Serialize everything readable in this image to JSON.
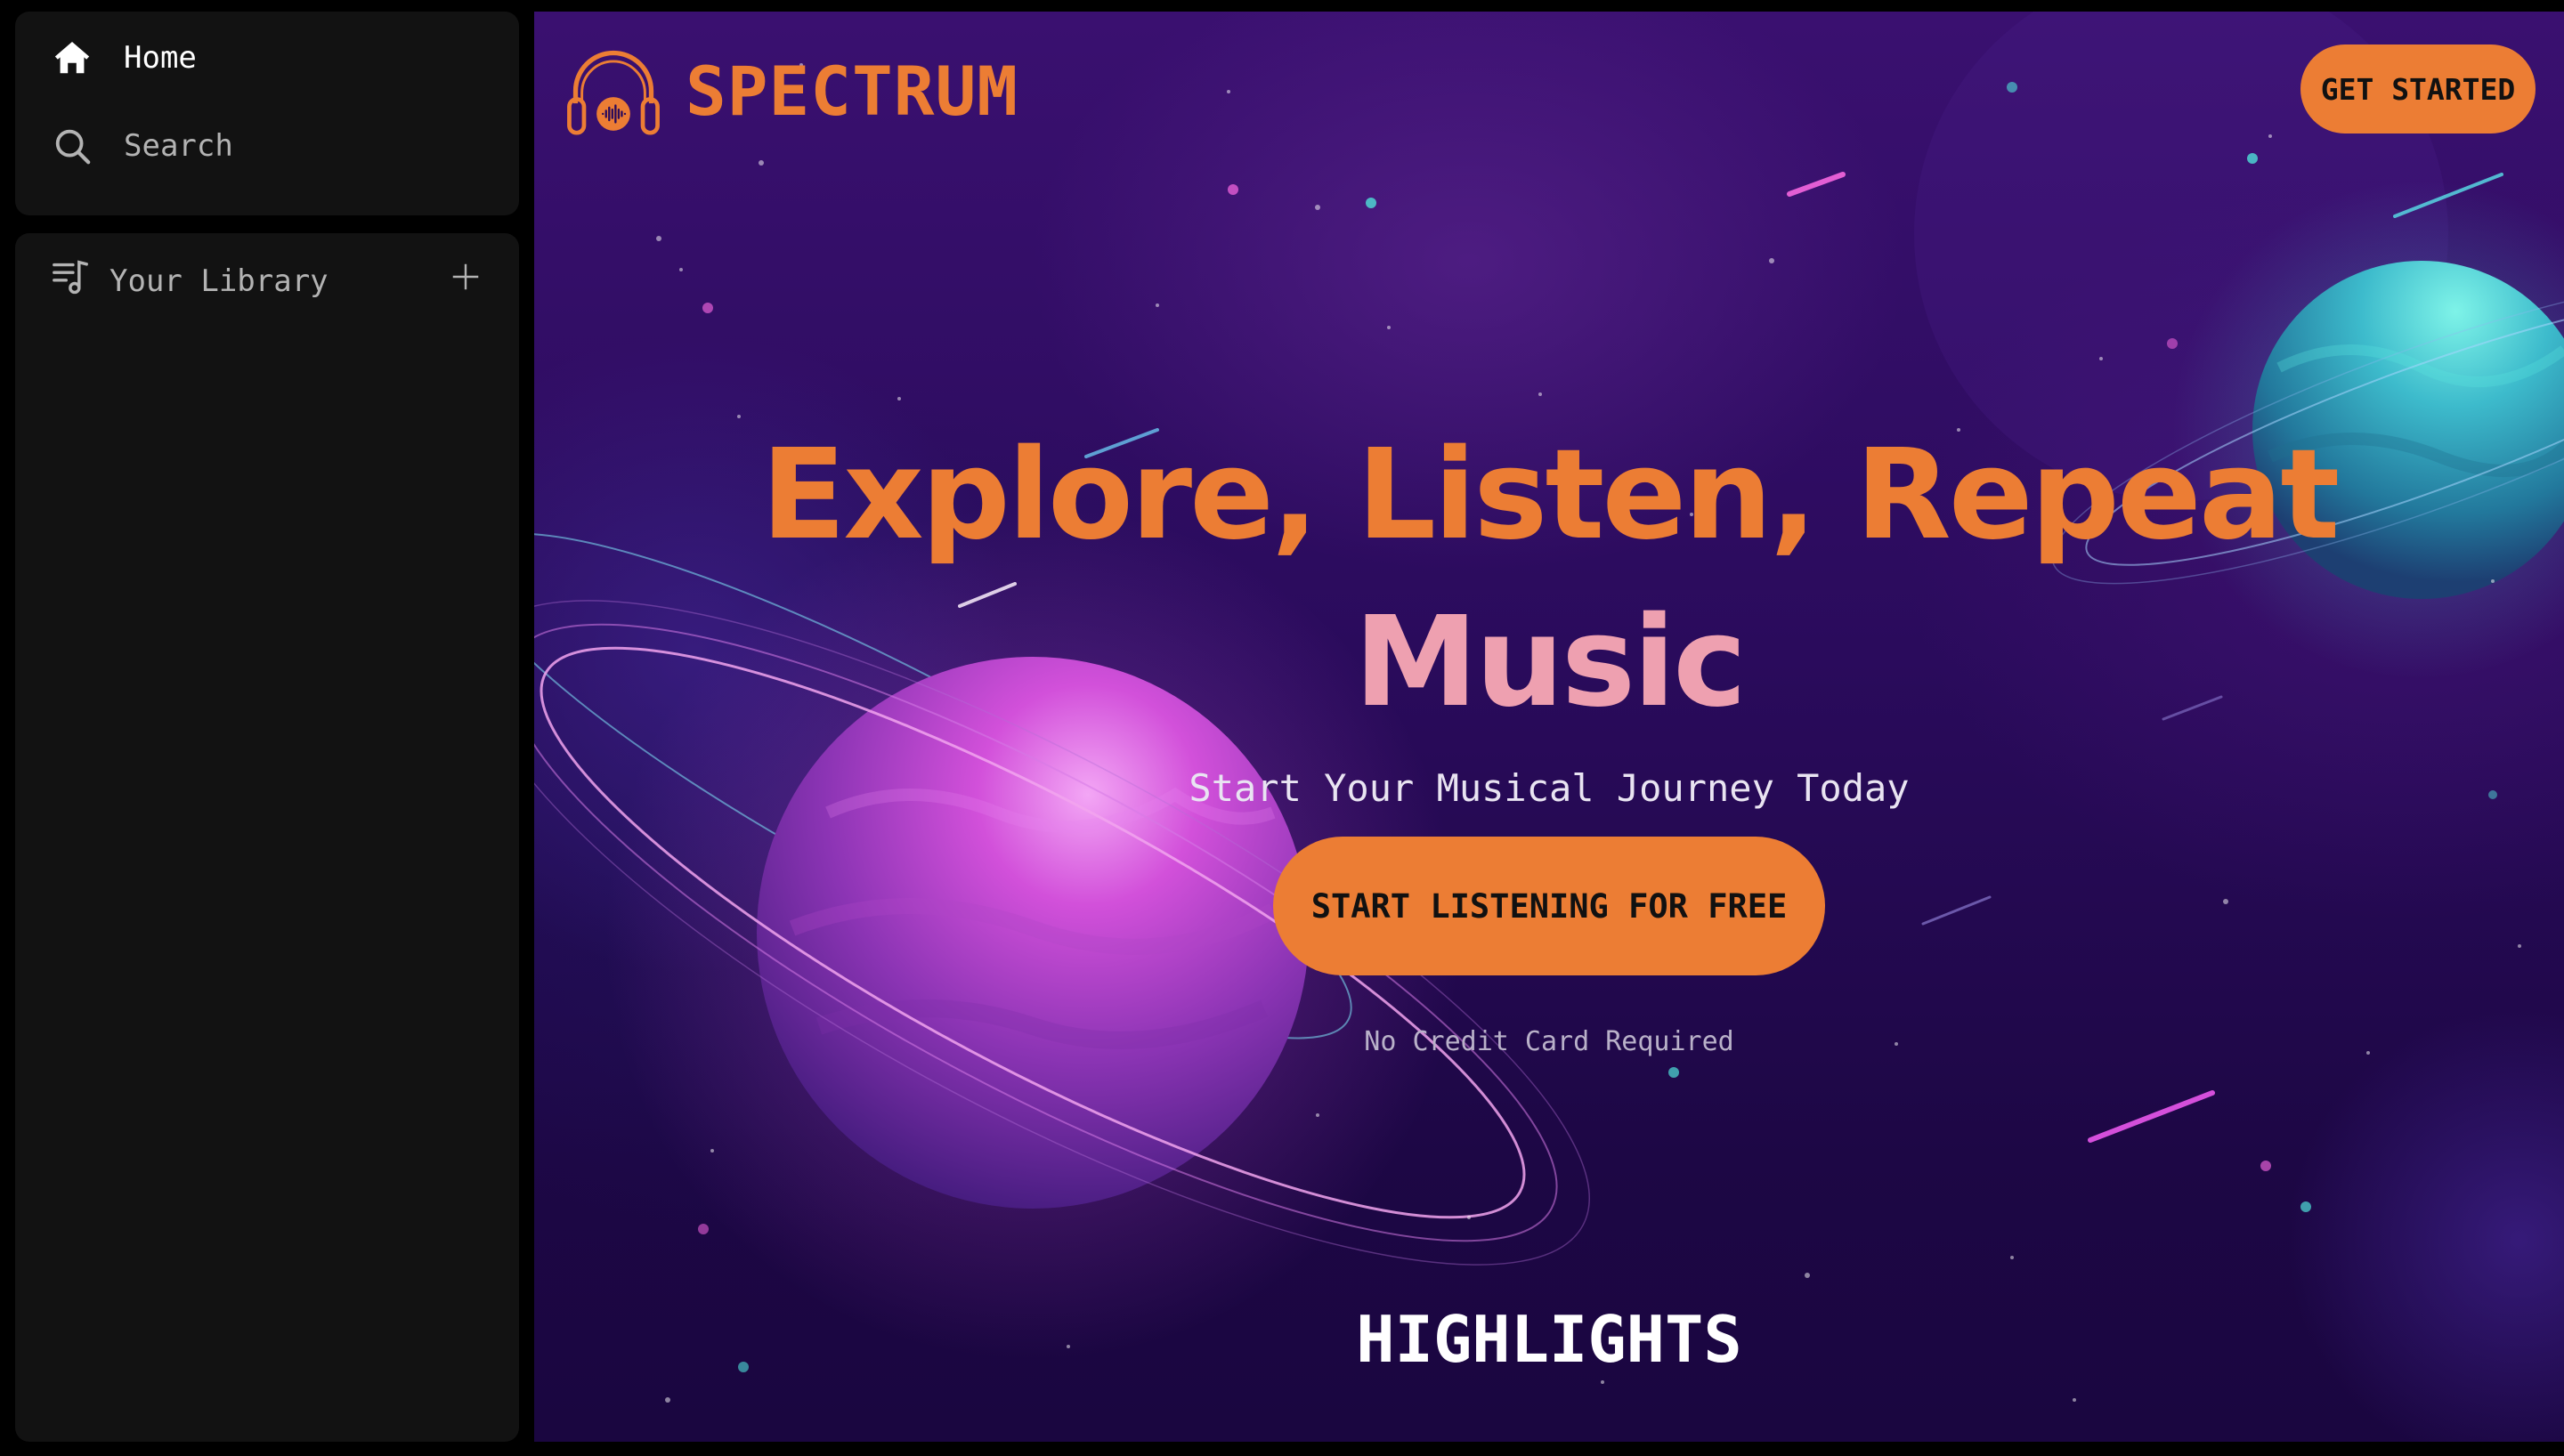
{
  "sidebar": {
    "nav": [
      {
        "label": "Home",
        "icon": "home-icon",
        "active": true
      },
      {
        "label": "Search",
        "icon": "search-icon",
        "active": false
      }
    ],
    "library": {
      "label": "Your Library",
      "icon": "library-icon",
      "add_icon": "plus-icon"
    }
  },
  "header": {
    "brand_name": "SPECTRUM",
    "logo_icon": "headphones-logo-icon",
    "cta_label": "GET STARTED"
  },
  "hero": {
    "title_line1": "Explore, Listen, Repeat",
    "title_line2": "Music",
    "subtitle": "Start Your Musical Journey Today",
    "cta_label": "START LISTENING FOR FREE",
    "note": "No Credit Card Required"
  },
  "sections": {
    "highlights_title": "HIGHLIGHTS"
  },
  "colors": {
    "accent": "#ec7d34",
    "title_secondary": "#eea0b0",
    "sidebar_bg": "#121212",
    "main_bg": "#2a0b5c"
  }
}
